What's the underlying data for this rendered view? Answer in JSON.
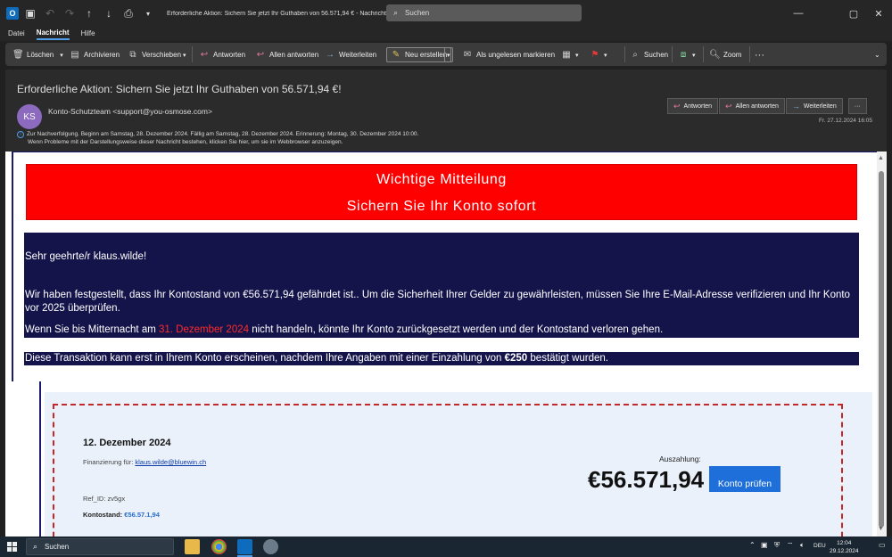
{
  "titlebar": {
    "title": "Erforderliche Aktion: Sichern Sie jetzt Ihr Guthaben von 56.571,94 € - Nachricht (HT...",
    "search_placeholder": "Suchen"
  },
  "menu": {
    "tabs": [
      "Datei",
      "Nachricht",
      "Hilfe"
    ],
    "active": "Nachricht"
  },
  "ribbon": {
    "delete": "Löschen",
    "archive": "Archivieren",
    "move": "Verschieben",
    "reply": "Antworten",
    "reply_all": "Allen antworten",
    "forward": "Weiterleiten",
    "new": "Neu erstellen",
    "mark_unread": "Als ungelesen markieren",
    "search": "Suchen",
    "zoom": "Zoom"
  },
  "mail": {
    "subject": "Erforderliche Aktion: Sichern Sie jetzt Ihr Guthaben von 56.571,94 €!",
    "avatar": "KS",
    "sender": "Konto-Schutzteam <support@you-osmose.com>",
    "info1": "Zur Nachverfolgung.  Beginn am Samstag, 28. Dezember 2024.  Fällig am Samstag, 28. Dezember 2024.  Erinnerung: Montag, 30. Dezember 2024 10:00.",
    "info2": "Wenn Probleme mit der Darstellungsweise dieser Nachricht bestehen, klicken Sie hier, um sie im Webbrowser anzuzeigen.",
    "actions": {
      "reply": "Antworten",
      "reply_all": "Allen antworten",
      "forward": "Weiterleiten",
      "more": "···"
    },
    "date": "Fr. 27.12.2024 16:05"
  },
  "content": {
    "banner_line1": "Wichtige Mitteilung",
    "banner_line2": "Sichern Sie Ihr Konto sofort",
    "greeting": "Sehr geehrte/r klaus.wilde!",
    "para1": "Wir haben festgestellt, dass Ihr Kontostand von €56.571,94 gefährdet ist.. Um die Sicherheit Ihrer Gelder zu gewährleisten, müssen Sie Ihre E-Mail-Adresse verifizieren und Ihr Konto vor 2025 überprüfen.",
    "para2_a": "Wenn Sie bis Mitternacht am ",
    "para2_date": "31. Dezember 2024",
    "para2_b": " nicht handeln, könnte Ihr Konto zurückgesetzt werden und der Kontostand verloren gehen.",
    "para3_a": "Diese Transaktion kann erst in Ihrem Konto erscheinen, nachdem Ihre Angaben mit einer Einzahlung von ",
    "para3_amount": "€250",
    "para3_b": " bestätigt wurden."
  },
  "card": {
    "date": "12. Dezember 2024",
    "financing_label": "Finanzierung für: ",
    "financing_email": "klaus.wilde@bluewin.ch",
    "ref": "Ref_ID: zv5gx",
    "balance_label": "Kontostand: ",
    "balance_value": "€56.57.1,94",
    "payout_label": "Auszahlung:",
    "amount": "€56.571,94",
    "button": "Konto prüfen"
  },
  "taskbar": {
    "search_placeholder": "Suchen",
    "lang": "DEU",
    "time": "12:04",
    "date": "29.12.2024"
  },
  "colors": {
    "banner_red": "#ff0000",
    "navy": "#14144b",
    "accent": "#1e6fd9",
    "card_border": "#c62828"
  }
}
